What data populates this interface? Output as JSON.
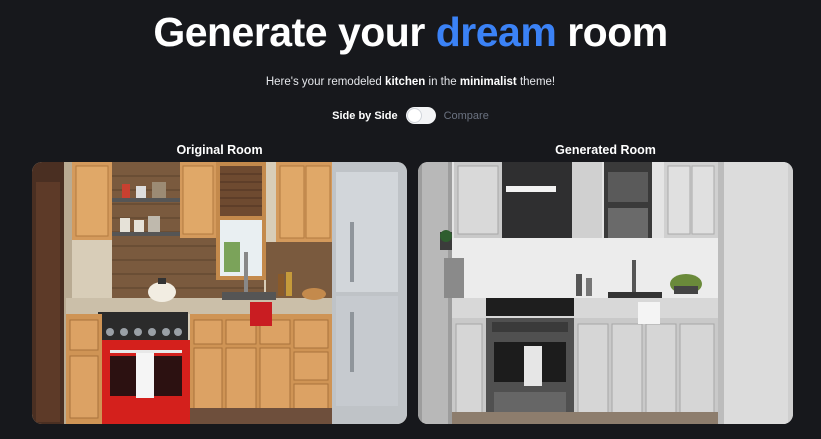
{
  "headline": {
    "before": "Generate your",
    "accent": "dream",
    "after": "room"
  },
  "subtitle": {
    "prefix": "Here's your remodeled",
    "room": "kitchen",
    "middle": "in the",
    "theme": "minimalist",
    "suffix": "theme!"
  },
  "toggle": {
    "left_label": "Side by Side",
    "right_label": "Compare"
  },
  "panels": {
    "original_title": "Original Room",
    "generated_title": "Generated Room"
  },
  "colors": {
    "accent": "#3b82f6",
    "background": "#17181c"
  }
}
